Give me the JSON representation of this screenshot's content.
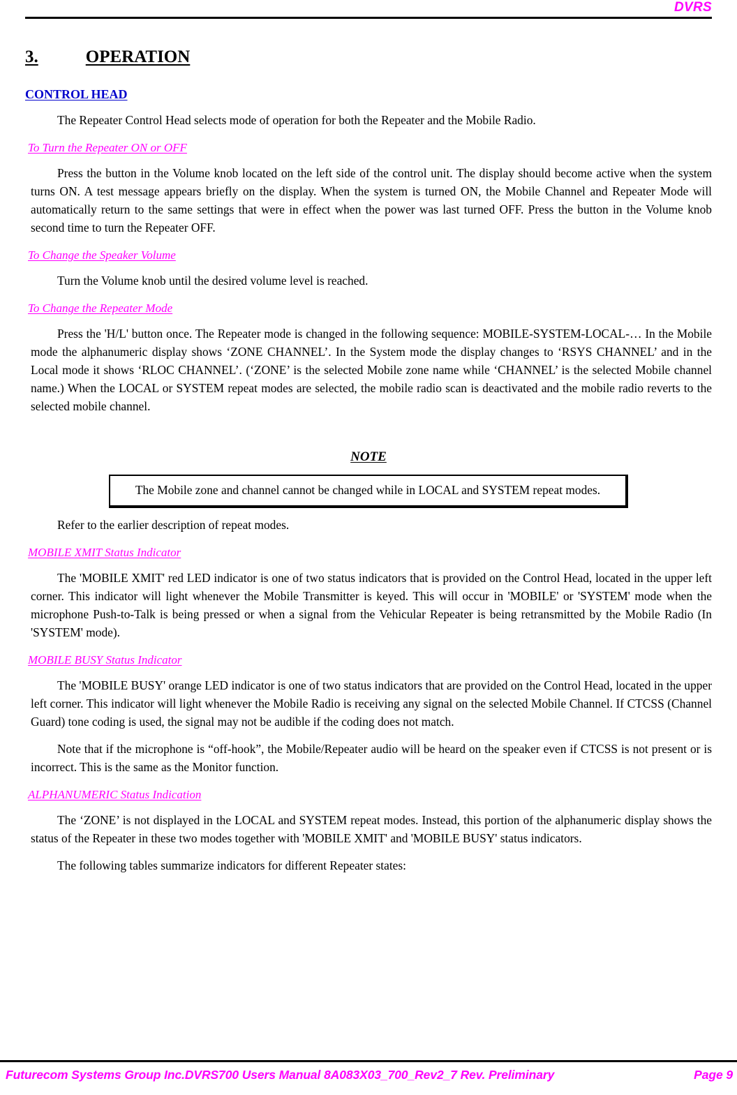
{
  "header": {
    "title": "DVRS"
  },
  "section": {
    "number": "3.",
    "title": "OPERATION"
  },
  "control_head": {
    "heading": "CONTROL HEAD",
    "intro": "The Repeater Control Head selects mode of operation for both the Repeater and the Mobile Radio."
  },
  "subsections": {
    "turn_on_off": {
      "heading": "To Turn the Repeater ON or OFF",
      "body": "Press the button in the Volume knob located on the left side of the control unit. The display should become active when the system turns ON. A test message appears briefly on the display. When the system is turned ON, the Mobile Channel and Repeater Mode will automatically return to the same settings that were in effect when the power was last turned OFF. Press the button in the Volume knob second time to turn the Repeater OFF."
    },
    "speaker_volume": {
      "heading": "To Change the Speaker Volume",
      "body": "Turn the Volume knob until the desired volume level is reached."
    },
    "repeater_mode": {
      "heading": "To Change the Repeater Mode",
      "body": "Press the 'H/L' button once. The Repeater mode is changed in the following sequence: MOBILE-SYSTEM-LOCAL-… In the Mobile mode the alphanumeric display shows ‘ZONE CHANNEL’. In the System mode the display changes to ‘RSYS CHANNEL’ and in the Local mode it shows ‘RLOC CHANNEL’. (‘ZONE’ is the selected Mobile zone name while ‘CHANNEL’ is the selected Mobile channel name.) When the LOCAL or SYSTEM repeat modes are selected, the mobile radio scan is deactivated and the mobile radio reverts to the selected mobile channel."
    },
    "refer_note": "Refer to the earlier description of repeat modes.",
    "mobile_xmit": {
      "heading": "MOBILE XMIT Status Indicator",
      "body": "The 'MOBILE XMIT' red LED indicator is one of two status indicators that is provided on the Control Head, located in the upper left corner. This indicator will light whenever the Mobile Transmitter is keyed. This will occur in 'MOBILE' or 'SYSTEM' mode when the microphone Push-to-Talk is being pressed or when a signal from the Vehicular Repeater is being retransmitted by the Mobile Radio (In 'SYSTEM' mode)."
    },
    "mobile_busy": {
      "heading": "MOBILE BUSY Status Indicator",
      "body": "The 'MOBILE BUSY' orange LED indicator is one of two status indicators that are provided on the Control Head, located in the upper left corner. This indicator will light whenever the Mobile Radio is receiving any signal on the selected Mobile Channel. If CTCSS (Channel Guard) tone coding is used, the signal may not be audible if the coding does not match.",
      "body2": "Note that if the microphone is “off-hook”, the Mobile/Repeater audio will be heard on the speaker even if CTCSS is not present or is incorrect. This is the same as the Monitor function."
    },
    "alphanumeric": {
      "heading": "ALPHANUMERIC Status Indication",
      "body": "The ‘ZONE’ is not displayed in the LOCAL and SYSTEM repeat modes. Instead, this portion of the alphanumeric display shows the status of the Repeater in these two modes together with 'MOBILE XMIT' and 'MOBILE BUSY' status indicators.",
      "body2": "The following tables summarize indicators for different Repeater states:"
    }
  },
  "note": {
    "title": "NOTE",
    "text": "The Mobile zone and channel cannot be changed while in LOCAL and SYSTEM repeat modes."
  },
  "footer": {
    "left": "Futurecom Systems Group Inc.DVRS700 Users Manual 8A083X03_700_Rev2_7 Rev. Preliminary",
    "right": "Page 9"
  },
  "colors": {
    "accent_magenta": "#FF00FF",
    "heading_blue": "#0000CC",
    "text_black": "#000000"
  }
}
